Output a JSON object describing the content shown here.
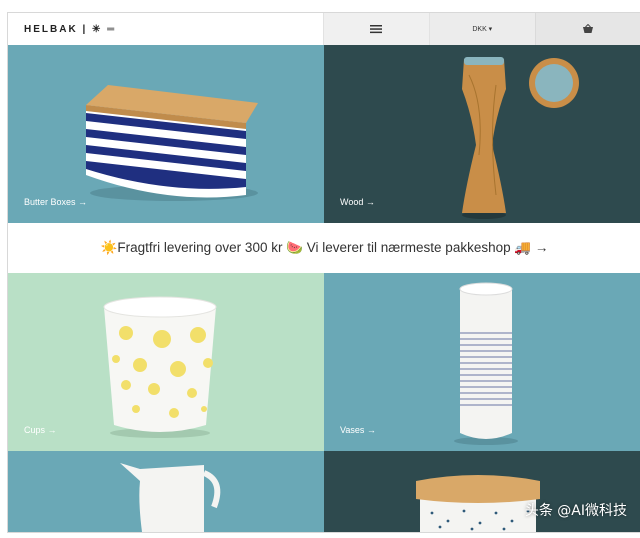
{
  "header": {
    "brand": "HELBAK | ✳ ═",
    "menu_icon": "hamburger-icon",
    "currency": "DKK ▾",
    "cart_icon": "basket-icon"
  },
  "tiles": [
    {
      "label": "Butter Boxes →",
      "color": "#6aa8b6"
    },
    {
      "label": "Wood →",
      "color": "#2e4a4e"
    },
    {
      "label": "Cups →",
      "color": "#b9e0c6"
    },
    {
      "label": "Vases →",
      "color": "#6aa8b6"
    },
    {
      "label": "",
      "color": "#6aa8b6"
    },
    {
      "label": "",
      "color": "#2e4a4e"
    }
  ],
  "banner": {
    "text": "☀️Fragtfri levering over 300 kr 🍉 Vi leverer til nærmeste pakkeshop 🚚 →"
  },
  "watermark": "头条 @AI微科技"
}
